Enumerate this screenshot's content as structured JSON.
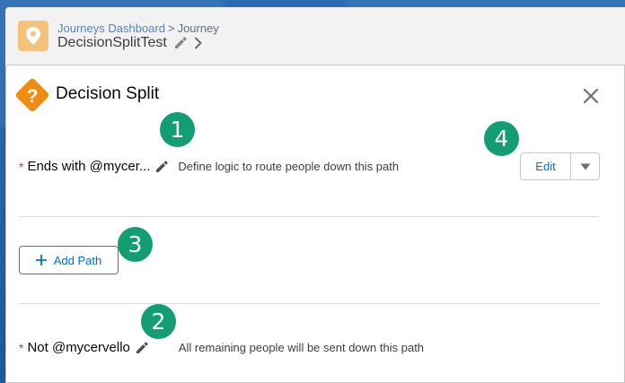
{
  "breadcrumb": {
    "parent": "Journeys Dashboard",
    "separator": ">",
    "current": "Journey"
  },
  "journey": {
    "title": "DecisionSplitTest"
  },
  "panel": {
    "title": "Decision Split"
  },
  "paths": [
    {
      "required": "*",
      "name": "Ends with @mycer...",
      "description": "Define logic to route people down this path"
    },
    {
      "required": "*",
      "name": "Not @mycervello",
      "description": "All remaining people will be sent down this path"
    }
  ],
  "actions": {
    "edit_label": "Edit",
    "add_path_label": "Add Path"
  },
  "annotations": [
    "1",
    "2",
    "3",
    "4"
  ],
  "colors": {
    "background": "#1f5fa8",
    "decision_icon": "#f18c13",
    "journey_badge": "#f5c27a",
    "link": "#0070d2",
    "required": "#c23934",
    "step_badge": "#129e72"
  },
  "icons": {
    "journey": "map-pin-icon",
    "decision": "question-diamond-icon",
    "close": "close-icon",
    "edit": "pencil-icon",
    "chevron": "chevron-right-icon",
    "menu": "caret-down-icon",
    "add": "plus-icon"
  }
}
